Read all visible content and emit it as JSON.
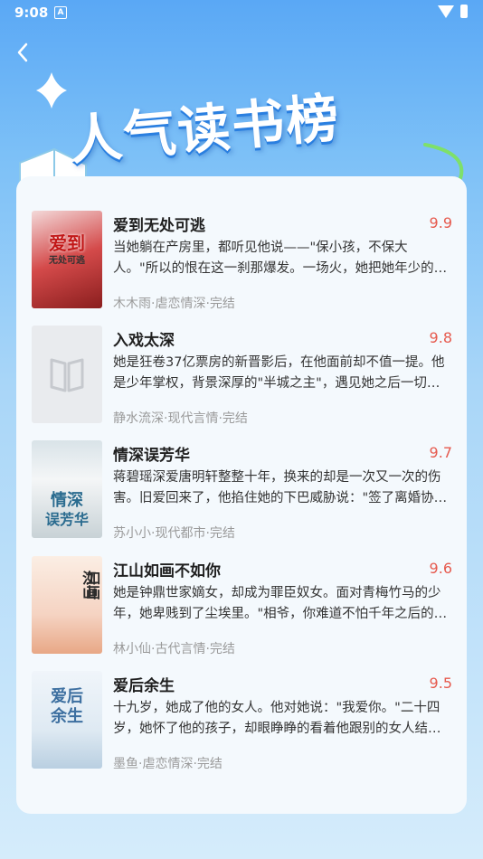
{
  "status": {
    "time": "9:08",
    "indicator": "A"
  },
  "header": {
    "title": "人气读书榜",
    "back_icon": "chevron-left-icon"
  },
  "books": [
    {
      "title": "爱到无处可逃",
      "score": "9.9",
      "desc": "当她躺在产房里，都听见他说——\"保小孩，不保大人。\"所以的恨在这一刹那爆发。一场火，她把她年少的爱恋付之一炬。",
      "meta": "木木雨·虐恋情深·完结",
      "cover_title": "爱到",
      "cover_sub": "无处可逃"
    },
    {
      "title": "入戏太深",
      "score": "9.8",
      "desc": "她是狂卷37亿票房的新晋影后，在他面前却不值一提。他是少年掌权，背景深厚的\"半城之主\"，遇见她之后一切都变了。",
      "meta": "静水流深·现代言情·完结",
      "cover_title": "",
      "cover_sub": ""
    },
    {
      "title": "情深误芳华",
      "score": "9.7",
      "desc": "蒋碧瑶深爱唐明轩整整十年，换来的却是一次又一次的伤害。旧爱回来了，他掐住她的下巴威胁说：\"签了离婚协议。\"",
      "meta": "苏小小·现代都市·完结",
      "cover_title": "情深",
      "cover_sub": "误芳华"
    },
    {
      "title": "江山如画不如你",
      "score": "9.6",
      "desc": "她是钟鼎世家嫡女，却成为罪臣奴女。面对青梅竹马的少年，她卑贱到了尘埃里。\"相爷，你难道不怕千年之后的骂名？\"",
      "meta": "林小仙·古代言情·完结",
      "cover_title": "江山",
      "cover_sub": "如画"
    },
    {
      "title": "爱后余生",
      "score": "9.5",
      "desc": "十九岁，她成了他的女人。他对她说：\"我爱你。\"二十四岁，她怀了他的孩子，却眼睁睁的看着他跟别的女人结婚。",
      "meta": "墨鱼·虐恋情深·完结",
      "cover_title": "爱后",
      "cover_sub": "余生"
    }
  ],
  "colors": {
    "score": "#e65a4e",
    "accent": "#2a7fe0"
  }
}
